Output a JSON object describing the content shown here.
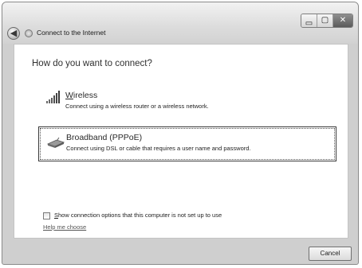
{
  "window": {
    "title": "Connect to the Internet",
    "caption_buttons": {
      "minimize": "▭",
      "maximize": "▢",
      "close": "✕"
    }
  },
  "back_button": {
    "glyph": "◀",
    "icon": "back-arrow-icon"
  },
  "main": {
    "heading": "How do you want to connect?",
    "options": [
      {
        "title": "Wireless",
        "description": "Connect using a wireless router or a wireless network.",
        "icon": "wireless-signal-icon",
        "selected": false
      },
      {
        "title": "Broadband (PPPoE)",
        "description": "Connect using DSL or cable that requires a user name and password.",
        "icon": "broadband-modem-icon",
        "selected": true
      }
    ],
    "checkbox": {
      "label": "Show connection options that this computer is not set up to use",
      "checked": false
    },
    "help_link": "Help me choose"
  },
  "footer": {
    "cancel_label": "Cancel"
  }
}
